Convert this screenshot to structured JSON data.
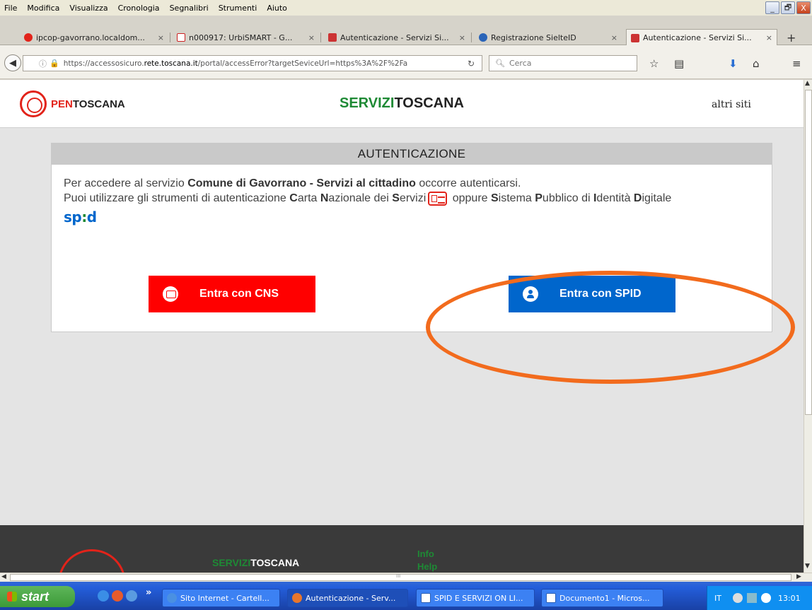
{
  "menu": {
    "items": [
      "File",
      "Modifica",
      "Visualizza",
      "Cronologia",
      "Segnalibri",
      "Strumenti",
      "Aiuto"
    ]
  },
  "window_buttons": {
    "minimize": "_",
    "restore": "🗗",
    "close": "X"
  },
  "tabs": [
    {
      "title": "ipcop-gavorrano.localdom...",
      "color": "#e2231a"
    },
    {
      "title": "n000917: UrbiSMART - G...",
      "color": "#c22"
    },
    {
      "title": "Autenticazione - Servizi Si...",
      "color": "#c33"
    },
    {
      "title": "Registrazione SielteID",
      "color": "#2a64b8"
    },
    {
      "title": "Autenticazione - Servizi Si...",
      "color": "#c33"
    }
  ],
  "tab_close": "×",
  "new_tab": "+",
  "nav": {
    "url_prefix": "https://accessosicuro.",
    "url_domain": "rete.toscana.it",
    "url_suffix": "/portal/accessError?targetSeviceUrl=https%3A%2F%2Fa",
    "search_placeholder": "Cerca"
  },
  "site": {
    "logo_red": "PEN",
    "logo_black": "TOSCANA",
    "title_green": "SERVIZI",
    "title_black": "TOSCANA",
    "altri": "altri siti"
  },
  "auth": {
    "heading": "AUTENTICAZIONE",
    "line1_pre": "Per accedere al servizio ",
    "line1_bold": "Comune di Gavorrano - Servizi al cittadino",
    "line1_post": " occorre autenticarsi.",
    "line2_a": "Puoi utilizzare gli strumenti di autenticazione ",
    "line2_C": "C",
    "line2_b": "arta ",
    "line2_N": "N",
    "line2_c": "azionale dei ",
    "line2_S": "S",
    "line2_d": "ervizi",
    "line2_e": " oppure ",
    "line2_S2": "S",
    "line2_f": "istema ",
    "line2_P": "P",
    "line2_g": "ubblico di ",
    "line2_I": "I",
    "line2_h": "dentità ",
    "line2_D": "D",
    "line2_i": "igitale",
    "spid_a": "sp",
    "spid_dot": ":",
    "spid_b": "d",
    "btn_cns": "Entra con CNS",
    "btn_spid": "Entra con SPID"
  },
  "footer": {
    "title_green": "SERVIZI",
    "title_white": "TOSCANA",
    "link1": "Info",
    "link2": "Help"
  },
  "taskbar": {
    "start": "start",
    "items": [
      {
        "label": "Sito Internet - Cartell...",
        "color": "#4a90e2"
      },
      {
        "label": "Autenticazione - Serv...",
        "color": "#e8762c"
      },
      {
        "label": "SPID E SERVIZI ON LI...",
        "color": "#2b5fb4"
      },
      {
        "label": "Documento1 - Micros...",
        "color": "#2b5fb4"
      }
    ],
    "lang": "IT",
    "clock": "13:01",
    "chevrons": "»"
  }
}
